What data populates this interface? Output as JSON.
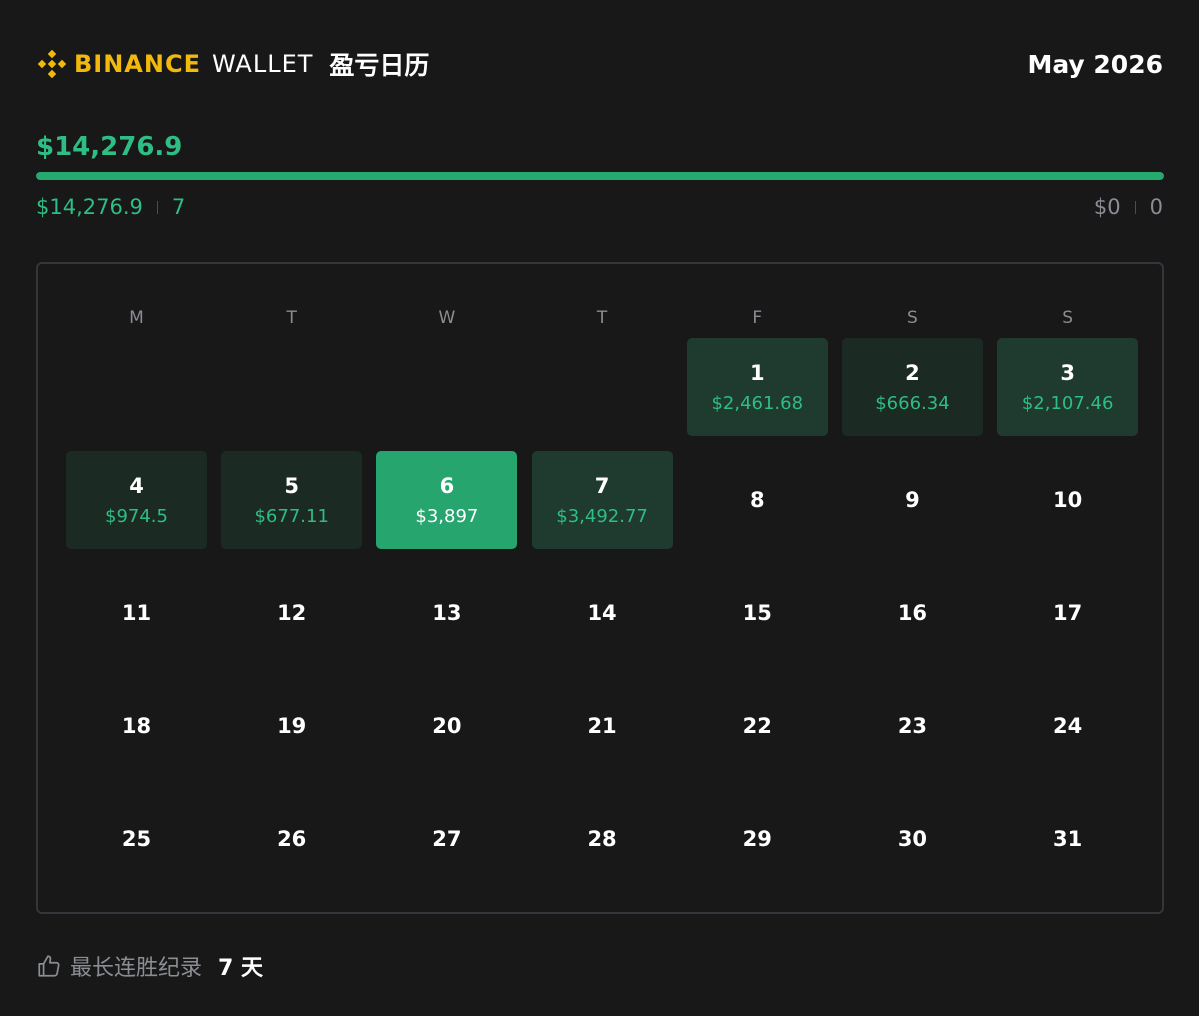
{
  "header": {
    "brand_name": "BINANCE",
    "brand_sub": "WALLET",
    "title": "盈亏日历",
    "month": "May 2026"
  },
  "summary": {
    "total": "$14,276.9",
    "win_fraction": 1.0,
    "profit_amount": "$14,276.9",
    "profit_days": "7",
    "loss_amount": "$0",
    "loss_days": "0"
  },
  "calendar": {
    "weekdays": [
      "M",
      "T",
      "W",
      "T",
      "F",
      "S",
      "S"
    ],
    "leading_blanks": 4,
    "days": [
      {
        "day": "1",
        "pnl": "$2,461.68",
        "state": "active"
      },
      {
        "day": "2",
        "pnl": "$666.34",
        "state": "dim"
      },
      {
        "day": "3",
        "pnl": "$2,107.46",
        "state": "active"
      },
      {
        "day": "4",
        "pnl": "$974.5",
        "state": "dim"
      },
      {
        "day": "5",
        "pnl": "$677.11",
        "state": "dim"
      },
      {
        "day": "6",
        "pnl": "$3,897",
        "state": "best"
      },
      {
        "day": "7",
        "pnl": "$3,492.77",
        "state": "active"
      },
      {
        "day": "8"
      },
      {
        "day": "9"
      },
      {
        "day": "10"
      },
      {
        "day": "11"
      },
      {
        "day": "12"
      },
      {
        "day": "13"
      },
      {
        "day": "14"
      },
      {
        "day": "15"
      },
      {
        "day": "16"
      },
      {
        "day": "17"
      },
      {
        "day": "18"
      },
      {
        "day": "19"
      },
      {
        "day": "20"
      },
      {
        "day": "21"
      },
      {
        "day": "22"
      },
      {
        "day": "23"
      },
      {
        "day": "24"
      },
      {
        "day": "25"
      },
      {
        "day": "26"
      },
      {
        "day": "27"
      },
      {
        "day": "28"
      },
      {
        "day": "29"
      },
      {
        "day": "30"
      },
      {
        "day": "31"
      }
    ]
  },
  "footer": {
    "icon": "thumbs-up-icon",
    "label": "最长连胜纪录",
    "value": "7 天"
  },
  "colors": {
    "brand": "#f0b90b",
    "profit": "#2ebd85",
    "best_day": "#27a56f",
    "background": "#181818"
  }
}
